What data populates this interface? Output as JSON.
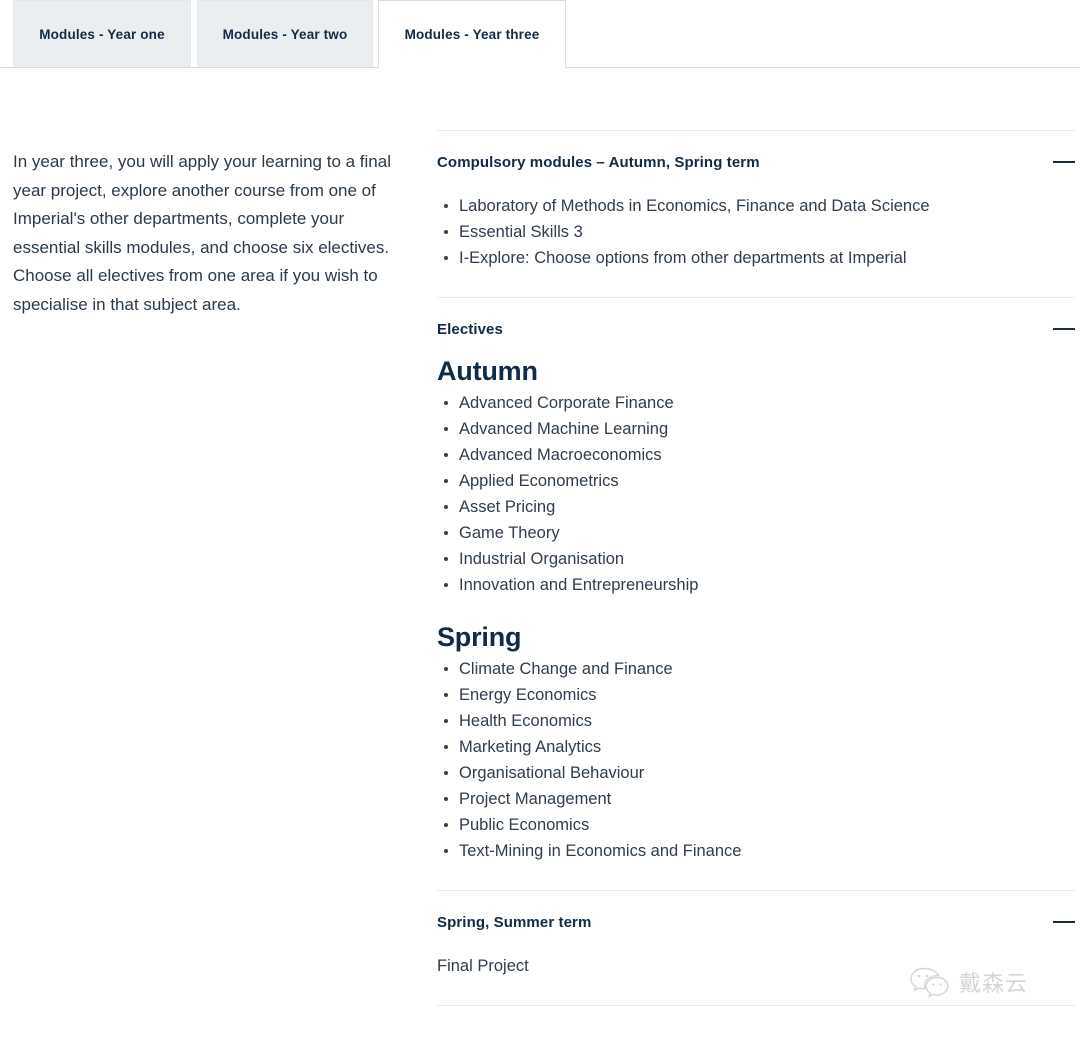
{
  "tabs": [
    {
      "label": "Modules - Year one",
      "active": false
    },
    {
      "label": "Modules - Year two",
      "active": false
    },
    {
      "label": "Modules - Year three",
      "active": true
    }
  ],
  "intro": {
    "paragraph": "In year three, you will apply your learning to a final year project, explore another course from one of Imperial's other departments, complete your essential skills modules, and choose six electives. Choose all electives from one area if you wish to specialise in that subject area."
  },
  "accordion": {
    "toggle_icon": "minus-icon",
    "sections": [
      {
        "title": "Compulsory modules – Autumn, Spring term",
        "items": [
          "Laboratory of Methods in Economics, Finance and Data Science",
          "Essential Skills 3",
          "I-Explore: Choose options from other departments at Imperial"
        ]
      },
      {
        "title": "Electives",
        "groups": [
          {
            "heading": "Autumn",
            "items": [
              "Advanced Corporate Finance",
              "Advanced Machine Learning",
              "Advanced Macroeconomics",
              "Applied Econometrics",
              "Asset Pricing",
              "Game Theory",
              "Industrial Organisation",
              "Innovation and Entrepreneurship"
            ]
          },
          {
            "heading": "Spring",
            "items": [
              "Climate Change and Finance",
              "Energy Economics",
              "Health Economics",
              "Marketing Analytics",
              "Organisational Behaviour",
              "Project Management",
              "Public Economics",
              "Text-Mining in Economics and Finance"
            ]
          }
        ]
      },
      {
        "title": "Spring, Summer term",
        "text": "Final Project"
      }
    ]
  },
  "watermark": {
    "icon": "wechat-icon",
    "text": "戴森云"
  },
  "colors": {
    "heading": "#102a47",
    "body": "#2f3d4c",
    "tab_inactive_bg": "#eaeef0",
    "divider": "#e8eaec"
  }
}
